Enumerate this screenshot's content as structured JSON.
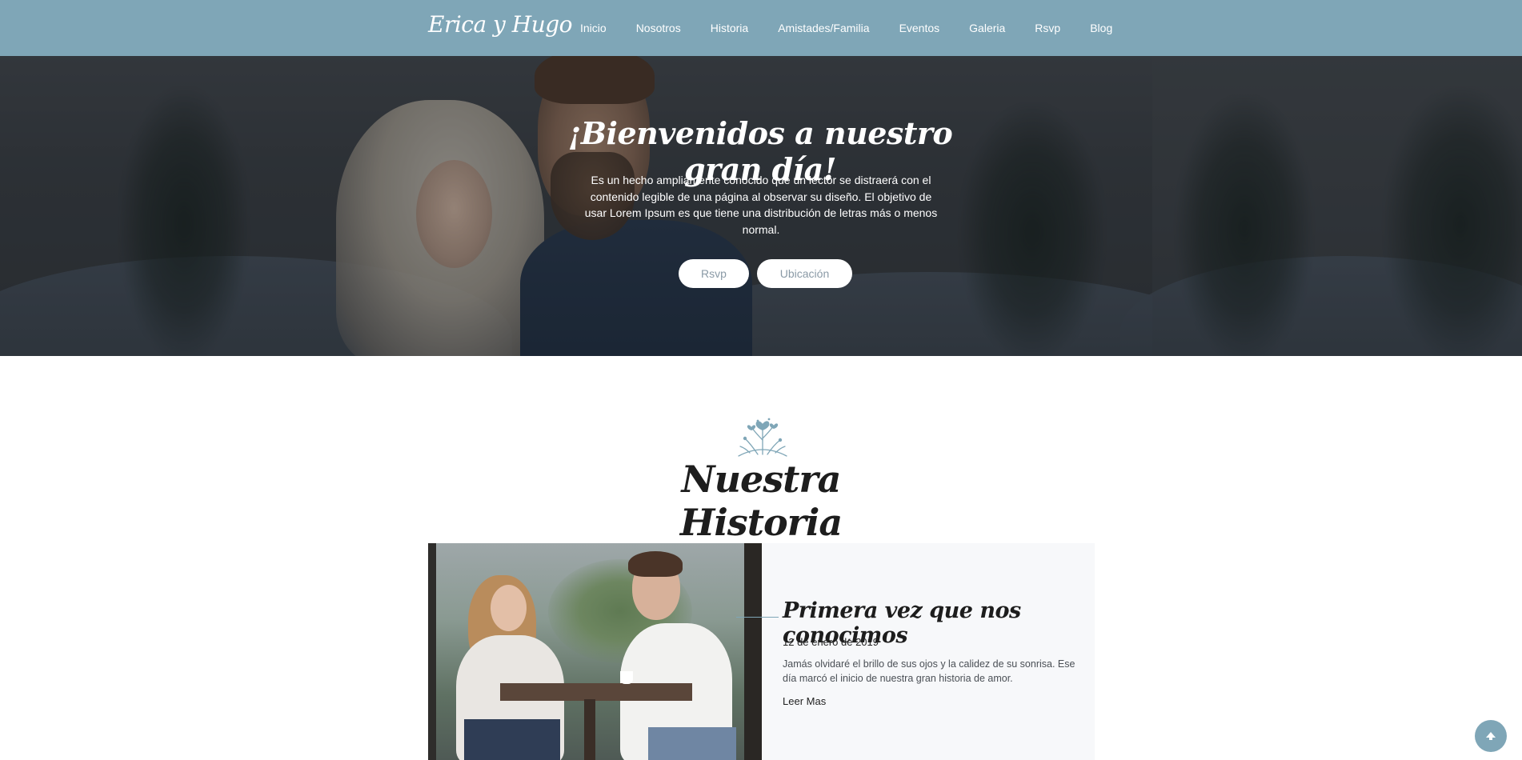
{
  "brand": "Erica y Hugo",
  "nav": {
    "items": [
      "Inicio",
      "Nosotros",
      "Historia",
      "Amistades/Familia",
      "Eventos",
      "Galeria",
      "Rsvp",
      "Blog"
    ]
  },
  "hero": {
    "title": "¡Bienvenidos a nuestro gran día!",
    "text": "Es un hecho ampliamente conocido que un lector se distraerá con el contenido legible de una página al observar su diseño. El objetivo de usar Lorem Ipsum es que tiene una distribución de letras más o menos normal.",
    "buttons": {
      "rsvp": "Rsvp",
      "location": "Ubicación"
    }
  },
  "story_section": {
    "title": "Nuestra Historia",
    "item": {
      "title": "Primera vez que nos conocimos",
      "date": "12 de enero de 2019",
      "text": "Jamás olvidaré el brillo de sus ojos y la calidez de su sonrisa. Ese día marcó el inicio de nuestra gran historia de amor.",
      "read_more": "Leer Mas"
    }
  },
  "colors": {
    "accent": "#7fa6b7",
    "card_bg": "#f7f8fa"
  },
  "icons": {
    "scroll_top": "arrow-up-icon",
    "flourish": "flower-ornament-icon"
  }
}
